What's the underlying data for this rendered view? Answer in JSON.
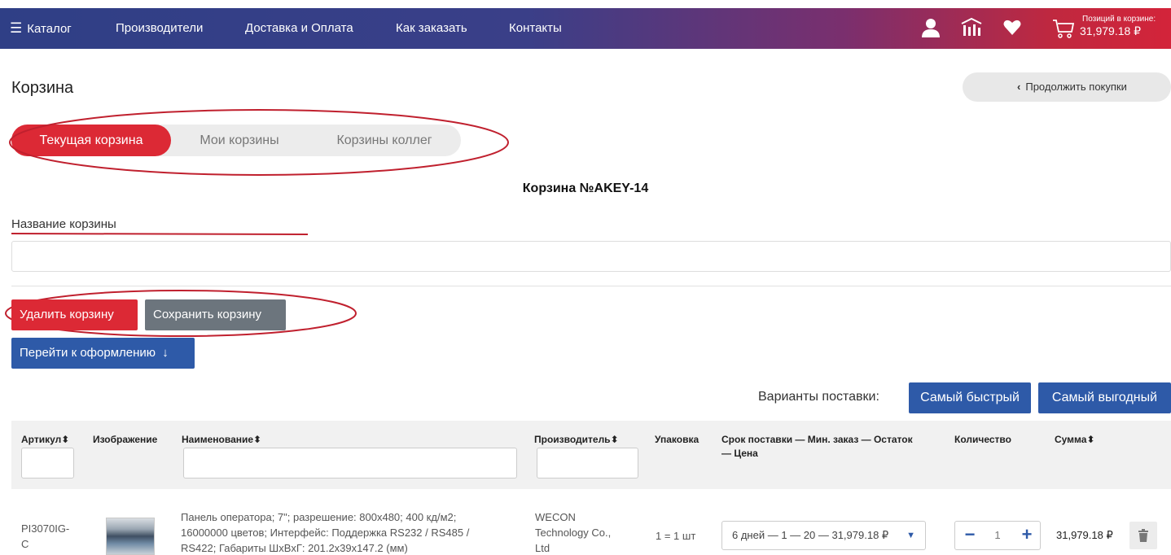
{
  "nav": {
    "catalog": "Каталог",
    "manufacturers": "Производители",
    "delivery": "Доставка и Оплата",
    "how_to_order": "Как заказать",
    "contacts": "Контакты",
    "icons": [
      "user-icon",
      "compare-icon",
      "heart-icon",
      "cart-icon"
    ],
    "cart_label": "Позиций в корзине:",
    "cart_total": "31,979.18 ₽"
  },
  "page": {
    "title": "Корзина",
    "continue_label": "Продолжить покупки"
  },
  "tabs": [
    {
      "label": "Текущая корзина",
      "active": true
    },
    {
      "label": "Мои корзины",
      "active": false
    },
    {
      "label": "Корзины коллег",
      "active": false
    }
  ],
  "basket": {
    "number_label": "Корзина №AKEY-14",
    "name_label": "Название корзины",
    "name_value": "",
    "delete_label": "Удалить корзину",
    "save_label": "Сохранить корзину",
    "checkout_label": "Перейти к оформлению"
  },
  "delivery": {
    "label": "Варианты поставки:",
    "fastest": "Самый быстрый",
    "cheapest": "Самый выгодный"
  },
  "table": {
    "headers": {
      "article": "Артикул",
      "image": "Изображение",
      "name": "Наименование",
      "manufacturer": "Производитель",
      "package": "Упаковка",
      "terms_line1": "Срок поставки — Мин. заказ — Остаток",
      "terms_line2": "— Цена",
      "quantity": "Количество",
      "sum": "Сумма"
    },
    "sort_glyph": "⬍",
    "rows": [
      {
        "article_1": "PI3070IG-",
        "article_2": "C",
        "desc_1": "Панель оператора; 7\"; разрешение: 800x480; 400 кд/м2;",
        "desc_2": "16000000 цветов; Интерфейс: Поддержка RS232 / RS485 /",
        "desc_3": "RS422; Габариты ШxВxГ: 201.2x39x147.2 (мм)",
        "manufacturer_1": "WECON",
        "manufacturer_2": "Technology Co.,",
        "manufacturer_3": "Ltd",
        "package": "1 = 1 шт",
        "delivery_option": "6 дней — 1 — 20 — 31,979.18 ₽",
        "quantity": "1",
        "sum": "31,979.18 ₽"
      }
    ]
  },
  "colors": {
    "accent_red": "#dc2935",
    "primary_blue": "#2e5aa8",
    "annotation_red": "#c0202e"
  }
}
